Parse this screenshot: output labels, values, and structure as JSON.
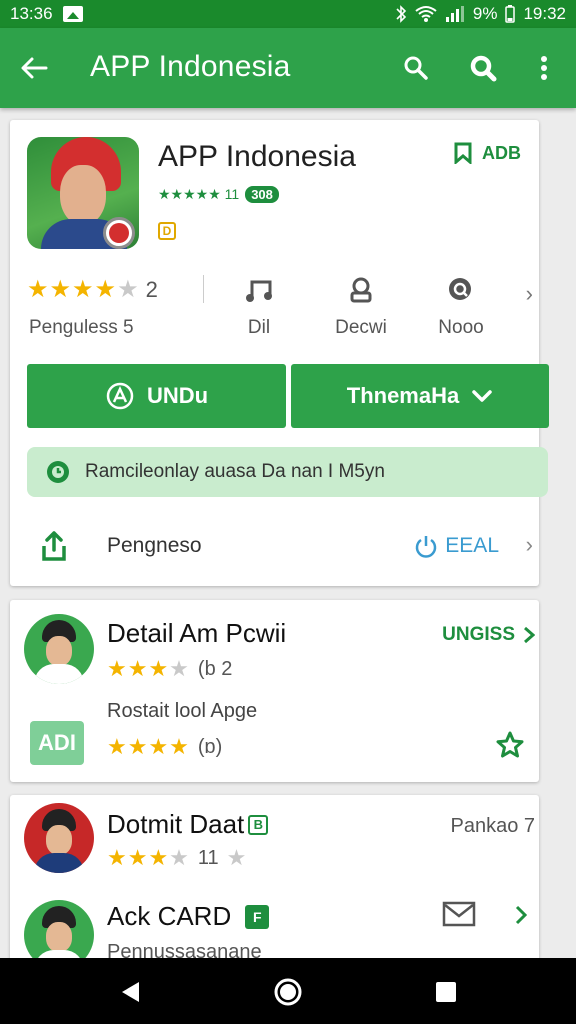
{
  "status_bar": {
    "left_time": "13:36",
    "battery_text": "9%",
    "time": "19:32"
  },
  "app_bar": {
    "title": "APP Indonesia"
  },
  "app": {
    "name": "APP Indonesia",
    "mini_stars": "★★★★★ 11",
    "mini_badge": "308",
    "tag": "D",
    "install_top_label": "ADB"
  },
  "stats": {
    "rating_stars": "★★★★",
    "rating_half": "★",
    "rating_count": "2",
    "rating_label": "Penguless 5",
    "items": [
      {
        "label": "Dil",
        "icon": "music-note-icon"
      },
      {
        "label": "Decwi",
        "icon": "account-icon"
      },
      {
        "label": "Nooo",
        "icon": "search-icon"
      }
    ],
    "more": "›"
  },
  "buttons": {
    "install": "UNDu",
    "secondary": "ThnemaHa"
  },
  "notice": {
    "text": "Ramcileonlay auasa Da nan I M5yn"
  },
  "share": {
    "label": "Pengneso",
    "action": "EEAL"
  },
  "list": [
    {
      "title": "Detail Am Pcwii",
      "action": "UNGISS",
      "stars": "★★★",
      "stars_half": "★",
      "stars_text": "(b  2",
      "sub": "Rostait lool Apge",
      "adi": "ADI",
      "stars2": "★★★★",
      "stars2_text": "(ɒ)"
    },
    {
      "title": "Dotmit Daat",
      "title_badge": "B",
      "action": "Pankao 7",
      "stars": "★★★",
      "stars_half": "★",
      "stars_text": "11",
      "stars_dim": "★"
    },
    {
      "title": "Ack CARD",
      "title_badge": "F",
      "sub": "Pennussasanane"
    }
  ],
  "colors": {
    "status_bar": "#1a8a2c",
    "app_bar": "#2ea24a",
    "accent_green": "#1e8e3e",
    "star": "#f4b400",
    "notice_bg": "#c9ecce",
    "link_blue": "#3a9bd0"
  }
}
